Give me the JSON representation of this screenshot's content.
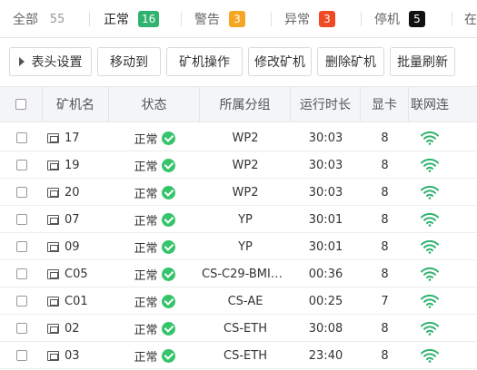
{
  "tabs": [
    {
      "label": "全部",
      "count": "55",
      "color": ""
    },
    {
      "label": "正常",
      "count": "16",
      "color": "#2fb36e"
    },
    {
      "label": "警告",
      "count": "3",
      "color": "#f5a623"
    },
    {
      "label": "异常",
      "count": "3",
      "color": "#f04a24"
    },
    {
      "label": "停机",
      "count": "5",
      "color": "#111111"
    },
    {
      "label": "在",
      "count": "",
      "color": ""
    }
  ],
  "active_tab": "正常",
  "toolbar": {
    "column_settings": "表头设置",
    "move_to": "移动到",
    "miner_ops": "矿机操作",
    "edit_miner": "修改矿机",
    "delete_miner": "删除矿机",
    "batch_refresh": "批量刷新"
  },
  "table": {
    "headers": [
      "矿机名",
      "状态",
      "所属分组",
      "运行时长",
      "显卡",
      "联网连"
    ],
    "rows": [
      {
        "name": "17",
        "status": "正常",
        "group": "WP2",
        "uptime": "30:03",
        "gpus": "8"
      },
      {
        "name": "19",
        "status": "正常",
        "group": "WP2",
        "uptime": "30:03",
        "gpus": "8"
      },
      {
        "name": "20",
        "status": "正常",
        "group": "WP2",
        "uptime": "30:03",
        "gpus": "8"
      },
      {
        "name": "07",
        "status": "正常",
        "group": "YP",
        "uptime": "30:01",
        "gpus": "8"
      },
      {
        "name": "09",
        "status": "正常",
        "group": "YP",
        "uptime": "30:01",
        "gpus": "8"
      },
      {
        "name": "C05",
        "status": "正常",
        "group": "CS-C29-BMIN…",
        "uptime": "00:36",
        "gpus": "8"
      },
      {
        "name": "C01",
        "status": "正常",
        "group": "CS-AE",
        "uptime": "00:25",
        "gpus": "7"
      },
      {
        "name": "02",
        "status": "正常",
        "group": "CS-ETH",
        "uptime": "30:08",
        "gpus": "8"
      },
      {
        "name": "03",
        "status": "正常",
        "group": "CS-ETH",
        "uptime": "23:40",
        "gpus": "8"
      }
    ]
  },
  "colors": {
    "status_ok": "#36c46b",
    "wifi": "#2fb36e",
    "accent": "#2b7de9"
  },
  "icons": {
    "status_ok": "check-circle-icon",
    "network": "wifi-icon",
    "miner": "miner-icon"
  }
}
